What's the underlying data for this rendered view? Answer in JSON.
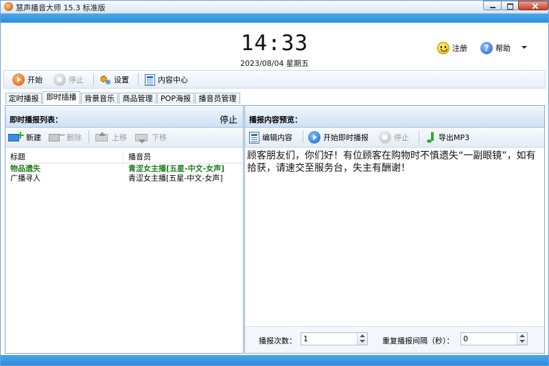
{
  "window": {
    "title": "慧声播音大师 15.3 标准版"
  },
  "clock": {
    "time": "14:33",
    "date": "2023/08/04 星期五"
  },
  "header": {
    "register_label": "注册",
    "help_label": "帮助"
  },
  "toolbar": {
    "start_label": "开始",
    "stop_label": "停止",
    "settings_label": "设置",
    "content_center_label": "内容中心"
  },
  "tabs": [
    {
      "label": "定时播报",
      "active": false
    },
    {
      "label": "即时插播",
      "active": true
    },
    {
      "label": "背景音乐",
      "active": false
    },
    {
      "label": "商品管理",
      "active": false
    },
    {
      "label": "POP海报",
      "active": false
    },
    {
      "label": "播音员管理",
      "active": false
    }
  ],
  "left_panel": {
    "title": "即时播报列表：",
    "status": "停止",
    "tools": {
      "new_label": "新建",
      "delete_label": "删除",
      "move_up_label": "上移",
      "move_down_label": "下移"
    },
    "columns": {
      "title": "标题",
      "announcer": "播音员"
    },
    "rows": [
      {
        "title": "物品遗失",
        "announcer": "青涩女主播[五星-中文-女声]",
        "selected": true
      },
      {
        "title": "广播寻人",
        "announcer": "青涩女主播[五星-中文-女声]",
        "selected": false
      }
    ]
  },
  "right_panel": {
    "title": "播报内容预览：",
    "tools": {
      "edit_label": "编辑内容",
      "start_instant_label": "开始即时播报",
      "stop_label": "停止",
      "export_label": "导出MP3"
    },
    "preview_text": "顾客朋友们，你们好！有位顾客在购物时不慎遗失“一副眼镜”，如有拾获，请速交至服务台，失主有酬谢！",
    "repeat_count_label": "播报次数：",
    "repeat_count_value": "1",
    "interval_label": "重复播报间隔（秒）：",
    "interval_value": "0"
  },
  "accent_color": "#2d8ddc"
}
